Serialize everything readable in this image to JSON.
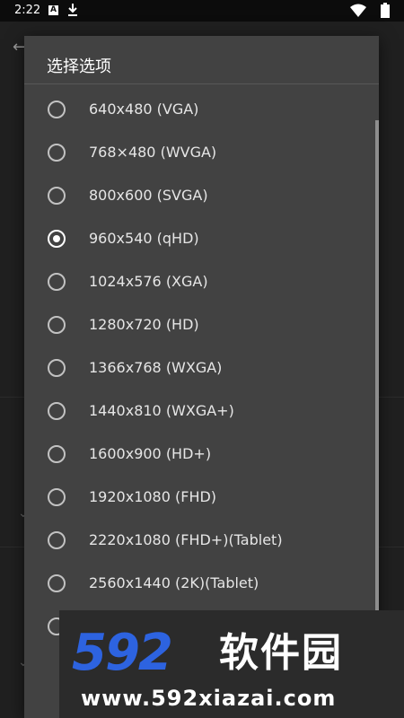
{
  "status_bar": {
    "time": "2:22",
    "icons": [
      "a-icon",
      "download-icon",
      "wifi-icon",
      "battery-icon"
    ]
  },
  "dialog": {
    "title": "选择选项",
    "selected_index": 3,
    "options": [
      "640x480 (VGA)",
      "768×480 (WVGA)",
      "800x600 (SVGA)",
      "960x540 (qHD)",
      "1024x576 (XGA)",
      "1280x720 (HD)",
      "1366x768 (WXGA)",
      "1440x810 (WXGA+)",
      "1600x900 (HD+)",
      "1920x1080 (FHD)",
      "2220x1080 (FHD+)(Tablet)",
      "2560x1440 (2K)(Tablet)",
      ""
    ]
  },
  "watermark": {
    "logo": "592",
    "brand": "软件园",
    "url": "www.592xiazai.com"
  },
  "colors": {
    "dialog_bg": "#424242",
    "text": "#e6e6e6",
    "watermark_blue": "#2d63e0"
  }
}
